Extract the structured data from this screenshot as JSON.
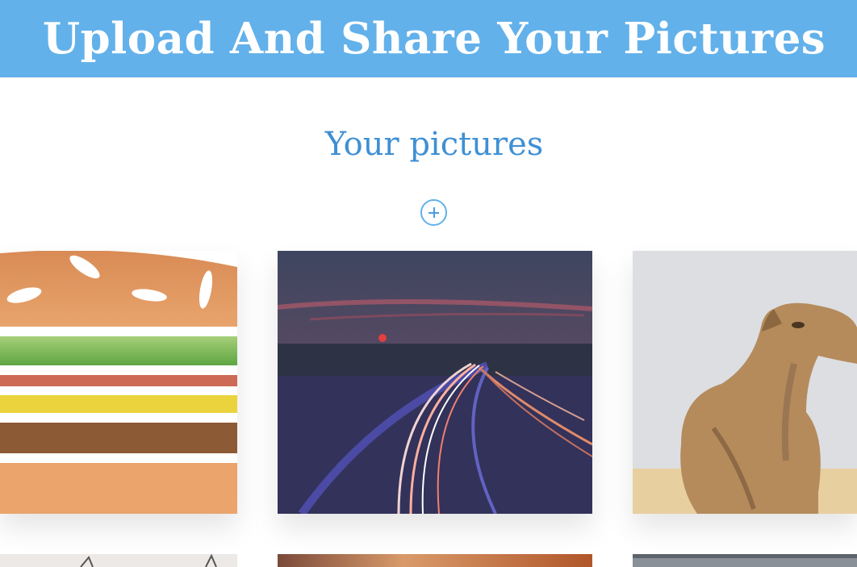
{
  "header": {
    "title": "Upload And Share Your Pictures"
  },
  "main": {
    "section_title": "Your pictures",
    "add_button": {
      "icon": "plus-icon"
    }
  },
  "gallery": {
    "pictures": [
      {
        "subject": "hamburger illustration"
      },
      {
        "subject": "highway light trails at dusk"
      },
      {
        "subject": "camel in desert"
      },
      {
        "subject": "bare tree"
      },
      {
        "subject": "sunset glow"
      },
      {
        "subject": "metal railing"
      }
    ]
  },
  "colors": {
    "header_bg": "#62b1ea",
    "title_text": "#ffffff",
    "section_title": "#3f90d4",
    "accent": "#62b1ea"
  }
}
